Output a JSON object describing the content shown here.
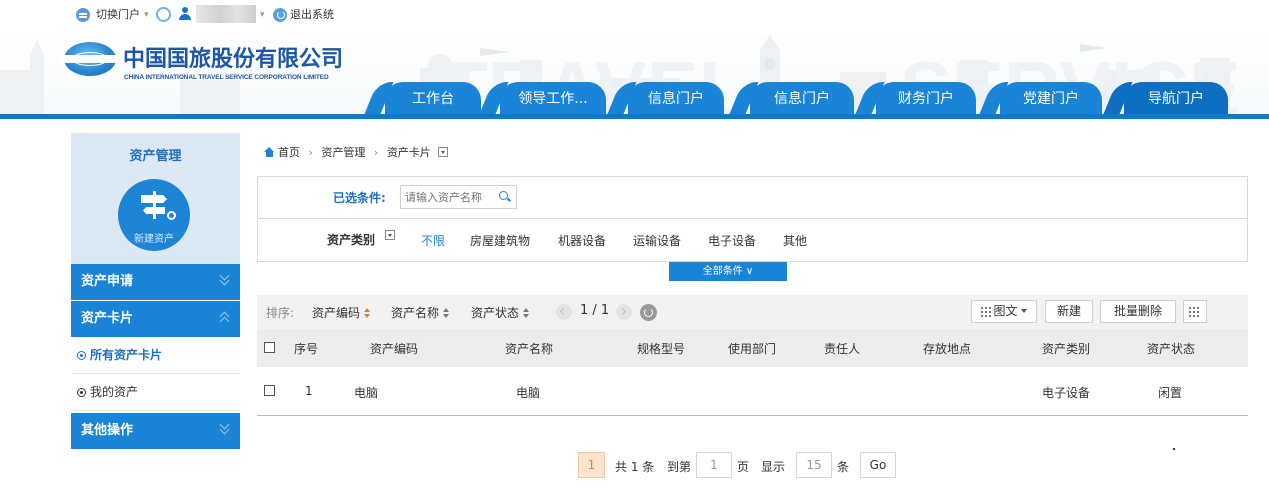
{
  "topbar": {
    "switch_portal": "切换门户",
    "logout": "退出系统"
  },
  "banner": {
    "logo_badge": "CITS",
    "company_cn": "中国国旅股份有限公司",
    "company_en": "CHINA INTERNATIONAL TRAVEL SERVICE CORPORATION LIMITED"
  },
  "nav_tabs": [
    {
      "label": "工作台"
    },
    {
      "label": "领导工作..."
    },
    {
      "label": "信息门户"
    },
    {
      "label": "信息门户"
    },
    {
      "label": "财务门户"
    },
    {
      "label": "党建门户"
    },
    {
      "label": "导航门户",
      "active": true
    }
  ],
  "sidebar": {
    "title": "资产管理",
    "circle_label": "新建资产",
    "sections": [
      {
        "label": "资产申请"
      },
      {
        "label": "资产卡片"
      },
      {
        "label": "其他操作"
      }
    ],
    "items": [
      {
        "label": "所有资产卡片",
        "active": true
      },
      {
        "label": "我的资产"
      }
    ]
  },
  "breadcrumb": {
    "home": "首页",
    "level1": "资产管理",
    "level2": "资产卡片"
  },
  "filter": {
    "selected_label": "已选条件:",
    "search_placeholder": "请输入资产名称",
    "category_label": "资产类别",
    "options": [
      "不限",
      "房屋建筑物",
      "机器设备",
      "运输设备",
      "电子设备",
      "其他"
    ],
    "selected_option": "不限",
    "all_conditions": "全部条件 ∨"
  },
  "toolbar": {
    "sort_label": "排序:",
    "sort_fields": [
      "资产编码",
      "资产名称",
      "资产状态"
    ],
    "page_indicator": "1 / 1",
    "view_mode": "图文",
    "new_button": "新建",
    "batch_delete": "批量删除"
  },
  "table": {
    "headers": [
      "序号",
      "资产编码",
      "资产名称",
      "规格型号",
      "使用部门",
      "责任人",
      "存放地点",
      "资产类别",
      "资产状态"
    ],
    "rows": [
      {
        "no": "1",
        "code": "电脑",
        "name": "电脑",
        "spec": "",
        "dept": "",
        "owner": "",
        "location": "",
        "category": "电子设备",
        "status": "闲置"
      }
    ]
  },
  "pagination": {
    "current": "1",
    "total": "共 1 条",
    "goto_label": "到第",
    "goto_value": "1",
    "page_unit": "页",
    "show_label": "显示",
    "page_size": "15",
    "size_unit": "条",
    "go": "Go"
  },
  "colors": {
    "primary": "#1a84d6",
    "brand_text": "#1e56a6",
    "accent_orange": "#e67e22"
  }
}
